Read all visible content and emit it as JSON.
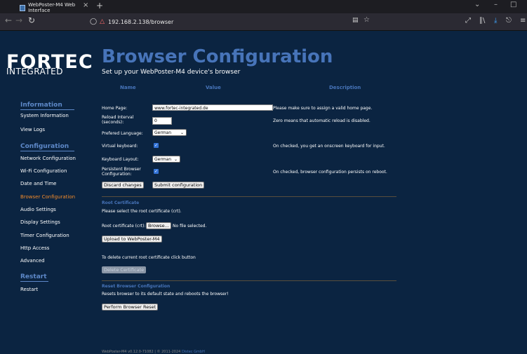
{
  "browser": {
    "tab_title": "WebPoster-M4 Web Interface",
    "tab_close": "×",
    "tab_new": "+",
    "url": "192.168.2.138/browser",
    "icons": [
      "back-icon",
      "forward-icon",
      "reload-icon",
      "shield-icon",
      "lock-icon",
      "reader-icon",
      "bookmark-star-icon",
      "resize-icon",
      "library-icon",
      "download-icon",
      "account-icon",
      "menu-icon"
    ]
  },
  "logo": {
    "line1": "FORTEC",
    "line2": "INTEGRATED"
  },
  "page": {
    "title": "Browser Configuration",
    "subtitle": "Set up your WebPoster-M4 device's browser"
  },
  "sidebar": {
    "information_heading": "Information",
    "information_items": [
      "System Information",
      "View Logs"
    ],
    "configuration_heading": "Configuration",
    "configuration_items": [
      "Network Configuration",
      "Wi-Fi Configuration",
      "Date and Time",
      "Browser Configuration",
      "Audio Settings",
      "Display Settings",
      "Timer Configuration",
      "Http Access",
      "Advanced"
    ],
    "active_item": "Browser Configuration",
    "restart_heading": "Restart",
    "restart_items": [
      "Restart"
    ]
  },
  "columns": {
    "name": "Name",
    "value": "Value",
    "description": "Description"
  },
  "form": {
    "home_page_label": "Home Page:",
    "home_page_value": "www.fortec-integrated.de",
    "home_page_desc": "Please make sure to assign a valid home page.",
    "reload_label_1": "Reload Interval",
    "reload_label_2": "(seconds):",
    "reload_value": "0",
    "reload_desc": "Zero means that automatic reload is disabled.",
    "language_label": "Prefered Language:",
    "language_value": "German",
    "vkeyboard_label": "Virtual keyboard:",
    "vkeyboard_checked": true,
    "vkeyboard_desc": "On checked, you get an onscreen keyboard for input.",
    "layout_label": "Keyboard Layout:",
    "layout_value": "German",
    "persistent_label_1": "Persistent Browser",
    "persistent_label_2": "Configuration:",
    "persistent_checked": true,
    "persistent_desc": "On checked, browser configuration persists on reboot.",
    "discard_label": "Discard changes",
    "submit_label": "Submit configuration"
  },
  "root_cert": {
    "title": "Root Certificate",
    "instruction": "Please select the root certificate (crt).",
    "file_label": "Root certificate (crt):",
    "browse_label": "Browse...",
    "no_file": "No file selected.",
    "upload_label": "Upload to WebPoster-M4",
    "delete_instruction": "To delete current root certificate click button",
    "delete_label": "Delete Certificate"
  },
  "reset": {
    "title": "Reset Browser Configuration",
    "description": "Resets browser to its default state and reboots the browser!",
    "button_label": "Perform Browser Reset"
  },
  "footer": {
    "text": "WebPoster-M4 v0.12.0-71082 | © 2011-2024",
    "link": "Distec GmbH"
  }
}
